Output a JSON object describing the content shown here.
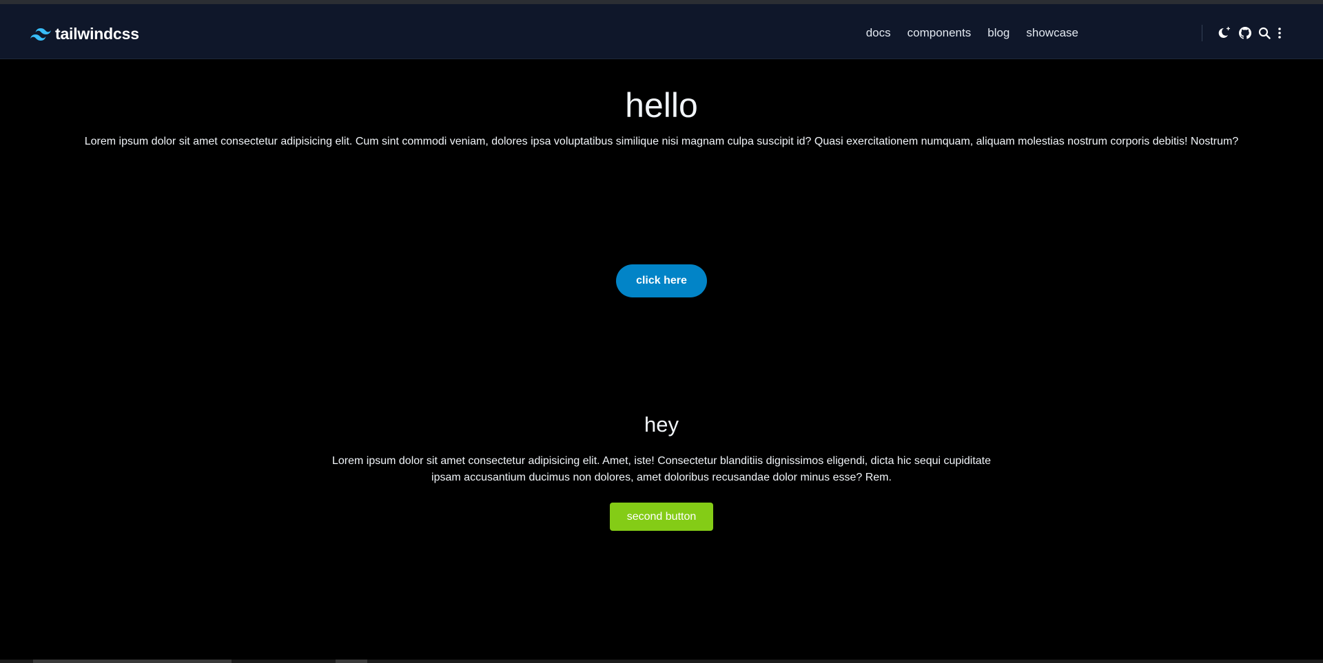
{
  "brand": {
    "logo_icon": "tailwind-wave-icon",
    "name": "tailwindcss",
    "accent": "#38bdf8"
  },
  "nav": {
    "links": [
      {
        "label": "docs"
      },
      {
        "label": "components"
      },
      {
        "label": "blog"
      },
      {
        "label": "showcase"
      }
    ],
    "icons": [
      "theme-toggle-moon-icon",
      "github-icon",
      "search-icon",
      "more-vertical-icon"
    ]
  },
  "hero": {
    "title": "hello",
    "text": "Lorem ipsum dolor sit amet consectetur adipisicing elit. Cum sint commodi veniam, dolores ipsa voluptatibus similique nisi magnam culpa suscipit id? Quasi exercitationem numquam, aliquam molestias nostrum corporis debitis! Nostrum?",
    "button_label": "click here",
    "button_color": "#0284c7"
  },
  "section": {
    "title": "hey",
    "text": "Lorem ipsum dolor sit amet consectetur adipisicing elit. Amet, iste! Consectetur blanditiis dignissimos eligendi, dicta hic sequi cupiditate ipsam accusantium ducimus non dolores, amet doloribus recusandae dolor minus esse? Rem.",
    "button_label": "second button",
    "button_color": "#84cc16"
  },
  "colors": {
    "background": "#000000",
    "navbar": "#0f172a"
  }
}
